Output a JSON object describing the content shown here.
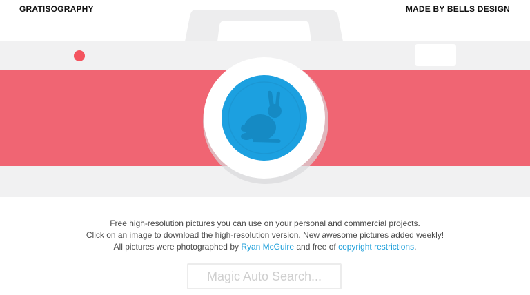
{
  "header": {
    "brand": "GRATISOGRAPHY",
    "credit": "MADE BY BELLS DESIGN"
  },
  "colors": {
    "camera_body": "#f1f1f2",
    "camera_top": "#ededee",
    "stripe": "#f06573",
    "record_dot": "#f4545f",
    "lens_ring": "#ffffff",
    "lens": "#1ca0e0",
    "rabbit": "#158ac4",
    "link": "#1e9fda"
  },
  "camera": {
    "lens_icon": "rabbit-icon"
  },
  "intro": {
    "line1": "Free high-resolution pictures you can use on your personal and commercial projects.",
    "line2": "Click on an image to download the high-resolution version. New awesome pictures added weekly!",
    "line3_prefix": "All pictures were photographed by ",
    "photographer_link": "Ryan McGuire",
    "line3_middle": " and free of ",
    "copyright_link": "copyright restrictions",
    "line3_suffix": "."
  },
  "search": {
    "placeholder": "Magic Auto Search..."
  }
}
